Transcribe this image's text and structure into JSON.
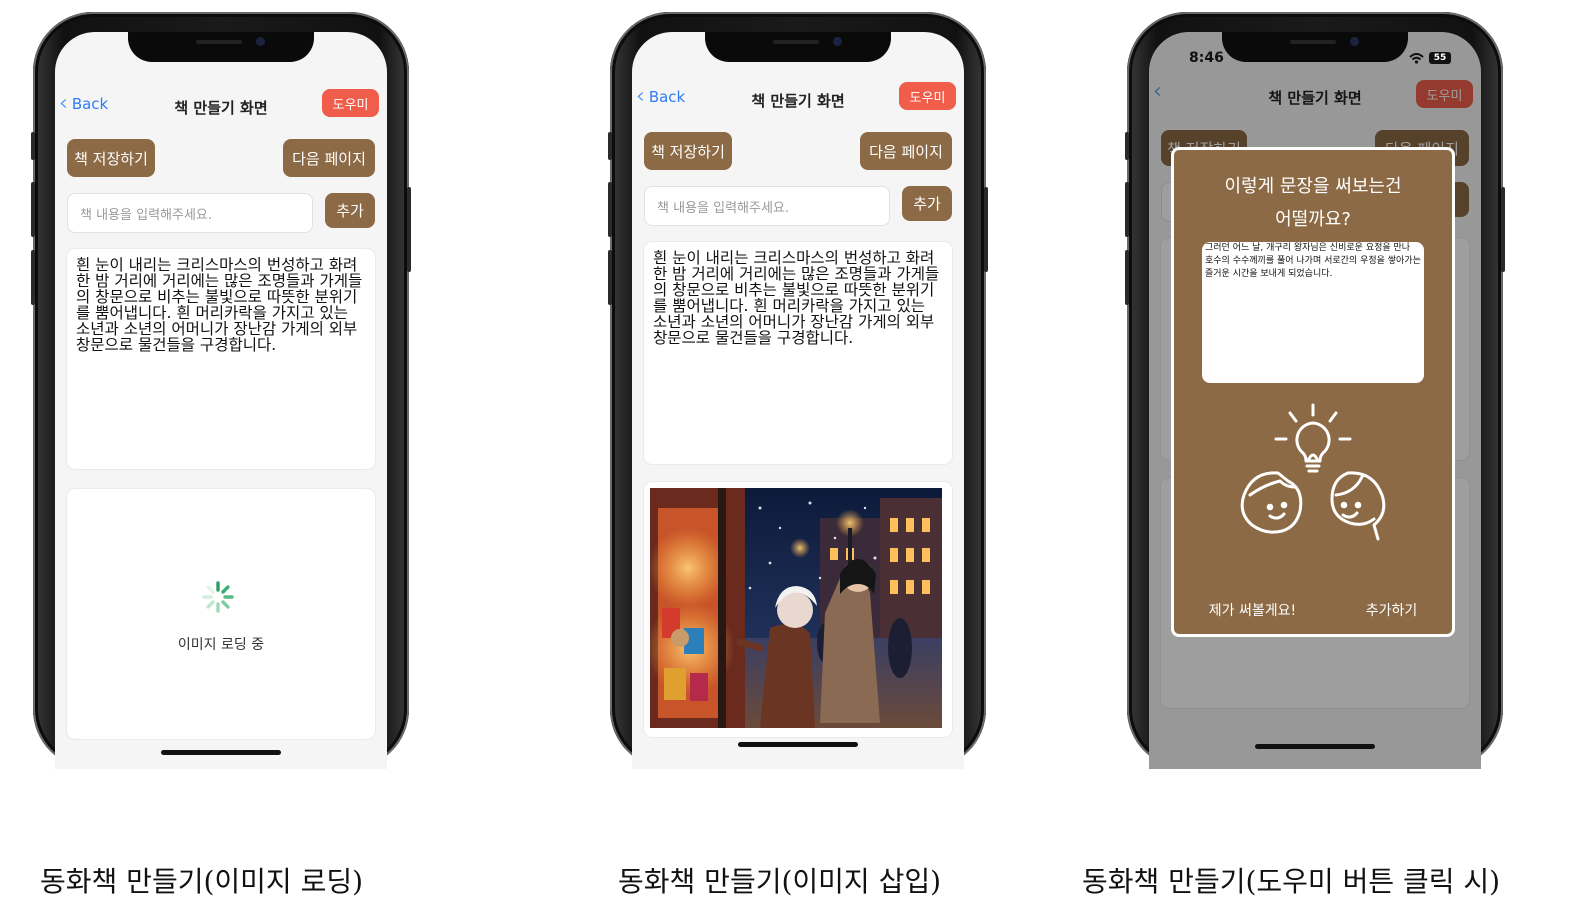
{
  "screens": [
    {
      "nav": {
        "back_label": "Back",
        "title": "책 만들기 화면",
        "help_label": "도우미"
      },
      "save_label": "책 저장하기",
      "next_label": "다음 페이지",
      "input_placeholder": "책 내용을 입력해주세요.",
      "add_label": "추가",
      "story_text": "흰 눈이 내리는 크리스마스의 번성하고 화려한 밤 거리에 거리에는 많은 조명들과 가게들의 창문으로 비추는 불빛으로 따뜻한 분위기를 뿜어냅니다. 흰 머리카락을 가지고 있는 소년과 소년의 어머니가 장난감 가게의 외부 창문으로 물건들을 구경합니다.",
      "loading_label": "이미지 로딩 중",
      "caption": "동화책 만들기(이미지 로딩)"
    },
    {
      "nav": {
        "back_label": "Back",
        "title": "책 만들기 화면",
        "help_label": "도우미"
      },
      "save_label": "책 저장하기",
      "next_label": "다음 페이지",
      "input_placeholder": "책 내용을 입력해주세요.",
      "add_label": "추가",
      "story_text": "흰 눈이 내리는 크리스마스의 번성하고 화려한 밤 거리에 거리에는 많은 조명들과 가게들의 창문으로 비추는 불빛으로 따뜻한 분위기를 뿜어냅니다. 흰 머리카락을 가지고 있는 소년과 소년의 어머니가 장난감 가게의 외부 창문으로 물건들을 구경합니다.",
      "caption": "동화책 만들기(이미지 삽입)"
    },
    {
      "status_time": "8:46",
      "battery": "55",
      "nav": {
        "title": "책 만들기 화면",
        "help_label": "도우미"
      },
      "save_label": "책 저장하기",
      "next_label": "다음 페이지",
      "modal": {
        "title_line1": "이렇게 문장을 써보는건",
        "title_line2": "어떨까요?",
        "suggestion": "그러던 어느 날, 개구리 왕자님은 신비로운 요정을 만나 호수의 수수께끼를 풀어 나가며 서로간의 우정을 쌓아가는 즐거운 시간을 보내게 되었습니다.",
        "write_myself_label": "제가 써볼게요!",
        "add_label": "추가하기"
      },
      "caption": "동화책 만들기(도우미 버튼 클릭 시)"
    }
  ],
  "colors": {
    "accent_brown": "#8c6a45",
    "help_red": "#f05e4b",
    "link_blue": "#2f7cf6"
  },
  "icons": [
    "back-chevron-icon",
    "loading-spinner-icon",
    "lightbulb-idea-icon",
    "wifi-icon",
    "battery-icon"
  ]
}
